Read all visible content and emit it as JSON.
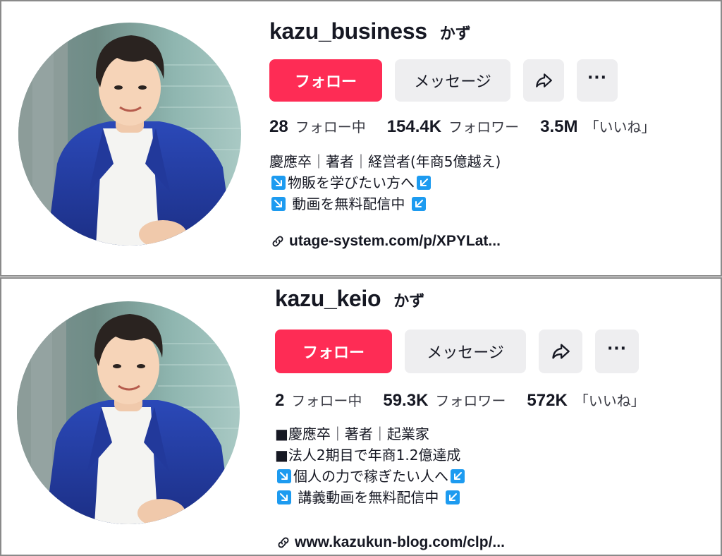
{
  "colors": {
    "follow": "#fe2c55",
    "grey_button": "#eeeef0",
    "arrow_badge": "#1d9bf0",
    "text": "#161823"
  },
  "profiles": [
    {
      "username": "kazu_business",
      "nickname": "かず",
      "buttons": {
        "follow": "フォロー",
        "message": "メッセージ",
        "share_icon": "share-icon",
        "more_icon": "more-icon"
      },
      "stats": [
        {
          "value": "28",
          "label": "フォロー中"
        },
        {
          "value": "154.4K",
          "label": "フォロワー"
        },
        {
          "value": "3.5M",
          "label": "「いいね」"
        }
      ],
      "bio": [
        "慶應卒｜著者｜経営者(年商5億越え)",
        "物販を学びたい方へ",
        " 動画を無料配信中 "
      ],
      "link": "utage-system.com/p/XPYLat..."
    },
    {
      "username": "kazu_keio",
      "nickname": "かず",
      "buttons": {
        "follow": "フォロー",
        "message": "メッセージ",
        "share_icon": "share-icon",
        "more_icon": "more-icon"
      },
      "stats": [
        {
          "value": "2",
          "label": "フォロー中"
        },
        {
          "value": "59.3K",
          "label": "フォロワー"
        },
        {
          "value": "572K",
          "label": "「いいね」"
        }
      ],
      "bio": [
        "■慶應卒｜著者｜起業家",
        "■法人2期目で年商1.2億達成",
        "個人の力で稼ぎたい人へ",
        " 講義動画を無料配信中 "
      ],
      "link": "www.kazukun-blog.com/clp/..."
    }
  ]
}
